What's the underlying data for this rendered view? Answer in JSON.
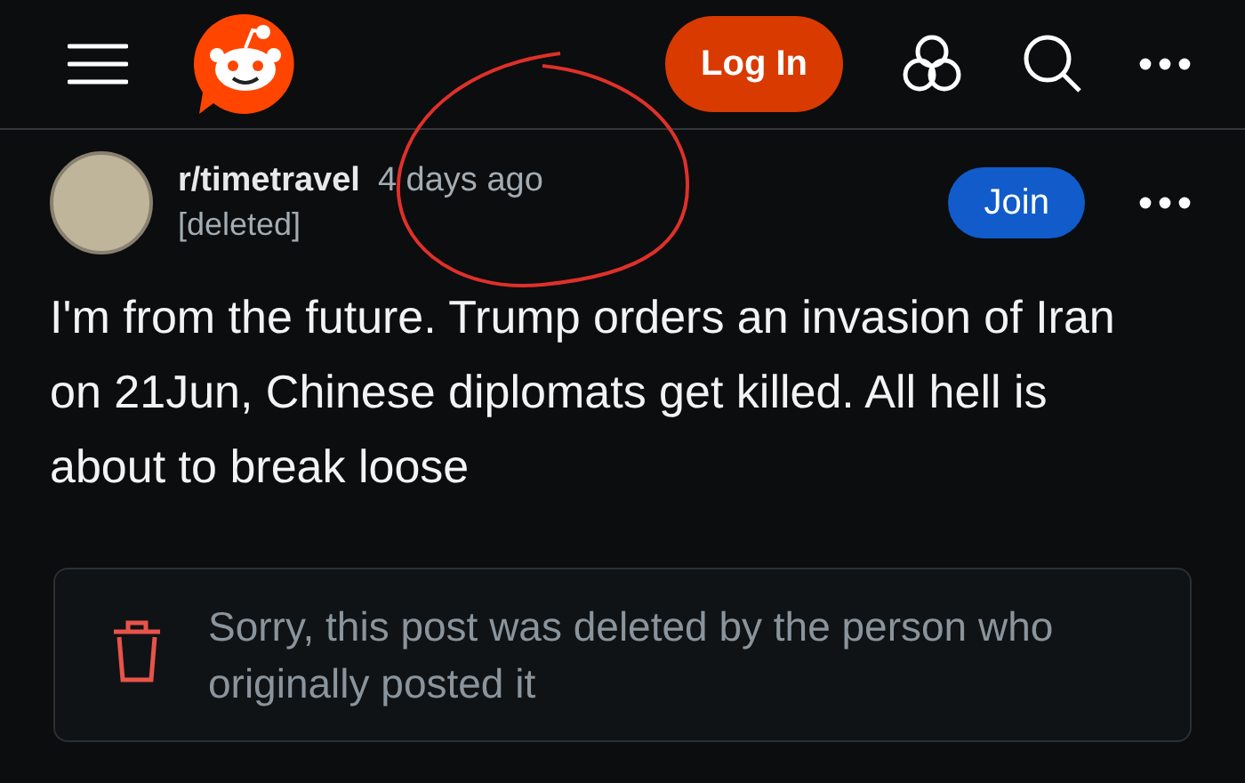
{
  "header": {
    "login_button": "Log In"
  },
  "post": {
    "subreddit": "r/timetravel",
    "time": "4 days ago",
    "author": "[deleted]",
    "join_button": "Join",
    "title": "I'm from the future. Trump orders an invasion of Iran on 21Jun, Chinese diplomats get killed. All hell is about to break loose",
    "deleted_notice": "Sorry, this post was deleted by the person who originally posted it"
  }
}
